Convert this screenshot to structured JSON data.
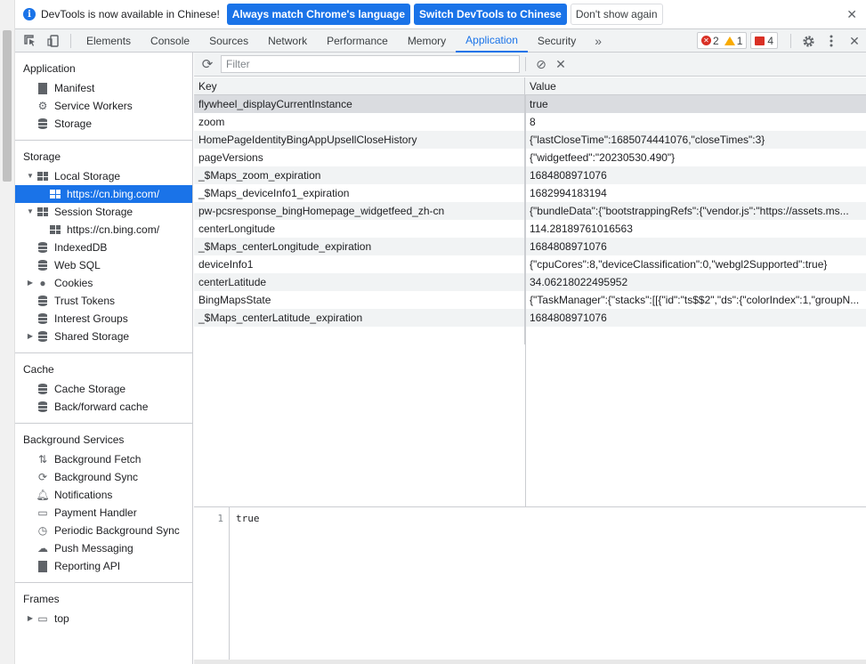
{
  "infobar": {
    "message": "DevTools is now available in Chinese!",
    "match_language_label": "Always match Chrome's language",
    "switch_label": "Switch DevTools to Chinese",
    "dont_show_label": "Don't show again"
  },
  "toolbar": {
    "tabs": [
      "Elements",
      "Console",
      "Sources",
      "Network",
      "Performance",
      "Memory",
      "Application",
      "Security"
    ],
    "active_tab": "Application",
    "more_tabs": "»",
    "error_count": "2",
    "warning_count": "1",
    "issue_count": "4"
  },
  "sidebar": {
    "application": {
      "title": "Application",
      "items": [
        "Manifest",
        "Service Workers",
        "Storage"
      ]
    },
    "storage": {
      "title": "Storage",
      "local_storage": "Local Storage",
      "local_origin": "https://cn.bing.com/",
      "session_storage": "Session Storage",
      "session_origin": "https://cn.bing.com/",
      "items": [
        "IndexedDB",
        "Web SQL",
        "Cookies",
        "Trust Tokens",
        "Interest Groups",
        "Shared Storage"
      ]
    },
    "cache": {
      "title": "Cache",
      "items": [
        "Cache Storage",
        "Back/forward cache"
      ]
    },
    "background": {
      "title": "Background Services",
      "items": [
        "Background Fetch",
        "Background Sync",
        "Notifications",
        "Payment Handler",
        "Periodic Background Sync",
        "Push Messaging",
        "Reporting API"
      ]
    },
    "frames": {
      "title": "Frames",
      "items": [
        "top"
      ]
    }
  },
  "filter": {
    "placeholder": "Filter"
  },
  "table": {
    "headers": {
      "key": "Key",
      "value": "Value"
    },
    "rows": [
      {
        "key": "flywheel_displayCurrentInstance",
        "value": "true"
      },
      {
        "key": "zoom",
        "value": "8"
      },
      {
        "key": "HomePageIdentityBingAppUpsellCloseHistory",
        "value": "{\"lastCloseTime\":1685074441076,\"closeTimes\":3}"
      },
      {
        "key": "pageVersions",
        "value": "{\"widgetfeed\":\"20230530.490\"}"
      },
      {
        "key": "_$Maps_zoom_expiration",
        "value": "1684808971076"
      },
      {
        "key": "_$Maps_deviceInfo1_expiration",
        "value": "1682994183194"
      },
      {
        "key": "pw-pcsresponse_bingHomepage_widgetfeed_zh-cn",
        "value": "{\"bundleData\":{\"bootstrappingRefs\":{\"vendor.js\":\"https://assets.ms..."
      },
      {
        "key": "centerLongitude",
        "value": "114.28189761016563"
      },
      {
        "key": "_$Maps_centerLongitude_expiration",
        "value": "1684808971076"
      },
      {
        "key": "deviceInfo1",
        "value": "{\"cpuCores\":8,\"deviceClassification\":0,\"webgl2Supported\":true}"
      },
      {
        "key": "centerLatitude",
        "value": "34.06218022495952"
      },
      {
        "key": "BingMapsState",
        "value": "{\"TaskManager\":{\"stacks\":[[{\"id\":\"ts$$2\",\"ds\":{\"colorIndex\":1,\"groupN..."
      },
      {
        "key": "_$Maps_centerLatitude_expiration",
        "value": "1684808971076"
      }
    ]
  },
  "preview": {
    "line_number": "1",
    "content": "true"
  }
}
